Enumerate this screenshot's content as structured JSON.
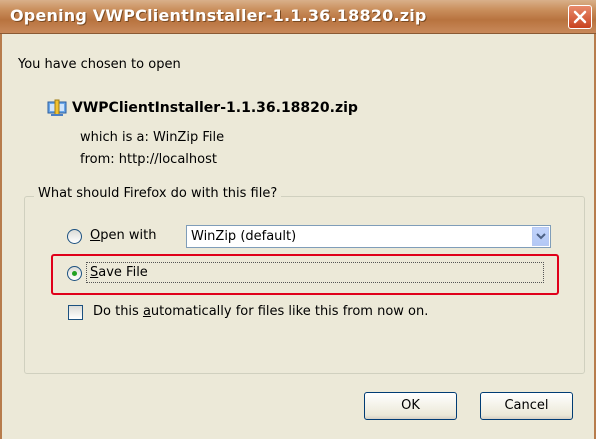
{
  "dialog": {
    "title": "Opening VWPClientInstaller-1.1.36.18820.zip",
    "close_icon": "close-icon"
  },
  "content": {
    "intro": "You have chosen to open",
    "filename": "VWPClientInstaller-1.1.36.18820.zip",
    "file_icon": "zip-file-icon",
    "which_is_label": "which is a:",
    "which_is_value": "WinZip File",
    "from_label": "from:",
    "from_value": "http://localhost"
  },
  "action_group": {
    "legend": "What should Firefox do with this file?",
    "open_with_label": "pen with",
    "open_with_mnemonic": "O",
    "open_with_selected": false,
    "app_select_value": "WinZip (default)",
    "save_file_label": "ave File",
    "save_file_mnemonic": "S",
    "save_file_selected": true,
    "auto_label_pre": "Do this ",
    "auto_label_mnemonic": "a",
    "auto_label_post": "utomatically for files like this from now on.",
    "auto_checked": false
  },
  "buttons": {
    "ok": "OK",
    "cancel": "Cancel"
  },
  "colors": {
    "highlight": "#e0001a",
    "titlebar": "#c98e5c"
  }
}
